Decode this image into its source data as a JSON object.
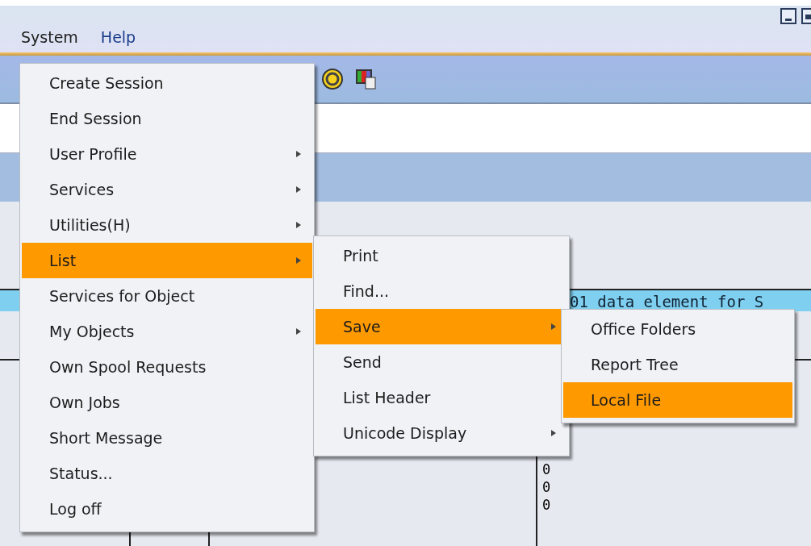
{
  "menu_bar": [
    {
      "label": "System",
      "selected": true
    },
    {
      "label": "Help",
      "selected": false
    }
  ],
  "list_row": {
    "text": "01 data element for S"
  },
  "list_values": [
    "0",
    "0",
    "0"
  ],
  "menus": [
    {
      "items": [
        {
          "label": "Create Session",
          "submenu": false,
          "selected": false
        },
        {
          "label": "End Session",
          "submenu": false,
          "selected": false
        },
        {
          "label": "User Profile",
          "submenu": true,
          "selected": false
        },
        {
          "label": "Services",
          "submenu": true,
          "selected": false
        },
        {
          "label": "Utilities(H)",
          "submenu": true,
          "selected": false
        },
        {
          "label": "List",
          "submenu": true,
          "selected": true
        },
        {
          "label": "Services for Object",
          "submenu": false,
          "selected": false
        },
        {
          "label": "My Objects",
          "submenu": true,
          "selected": false
        },
        {
          "label": "Own Spool Requests",
          "submenu": false,
          "selected": false
        },
        {
          "label": "Own Jobs",
          "submenu": false,
          "selected": false
        },
        {
          "label": "Short Message",
          "submenu": false,
          "selected": false
        },
        {
          "label": "Status...",
          "submenu": false,
          "selected": false
        },
        {
          "label": "Log off",
          "submenu": false,
          "selected": false
        }
      ]
    },
    {
      "items": [
        {
          "label": "Print",
          "submenu": false,
          "selected": false
        },
        {
          "label": "Find...",
          "submenu": false,
          "selected": false
        },
        {
          "label": "Save",
          "submenu": true,
          "selected": true
        },
        {
          "label": "Send",
          "submenu": false,
          "selected": false
        },
        {
          "label": "List Header",
          "submenu": false,
          "selected": false
        },
        {
          "label": "Unicode Display",
          "submenu": true,
          "selected": false
        }
      ]
    },
    {
      "items": [
        {
          "label": "Office Folders",
          "submenu": false,
          "selected": false
        },
        {
          "label": "Report Tree",
          "submenu": false,
          "selected": false
        },
        {
          "label": "Local File",
          "submenu": false,
          "selected": true
        }
      ]
    }
  ]
}
